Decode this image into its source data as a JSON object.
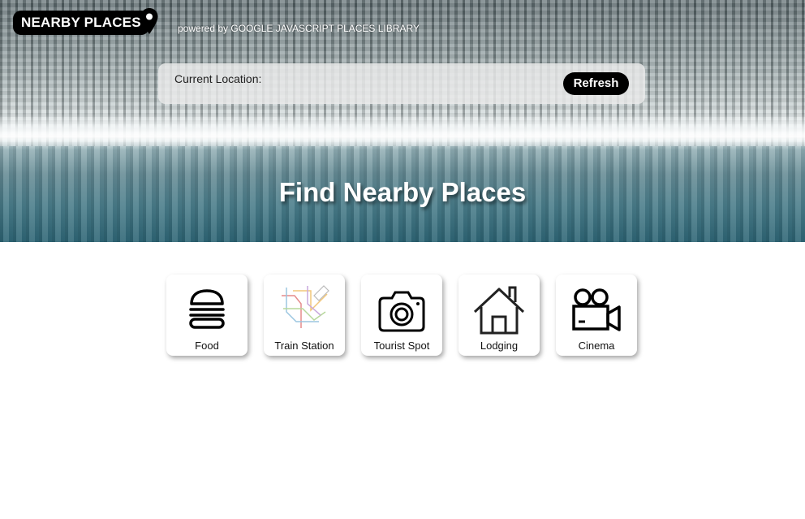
{
  "header": {
    "brand": "NEARBY PLACES",
    "powered_by": "powered by GOOGLE JAVASCRIPT PLACES LIBRARY",
    "pin_icon": "map-pin-icon"
  },
  "location": {
    "label": "Current Location:",
    "refresh_label": "Refresh"
  },
  "hero": {
    "title": "Find Nearby Places"
  },
  "categories": [
    {
      "label": "Food",
      "icon": "burger-icon"
    },
    {
      "label": "Train Station",
      "icon": "train-map-icon"
    },
    {
      "label": "Tourist Spot",
      "icon": "camera-icon"
    },
    {
      "label": "Lodging",
      "icon": "house-icon"
    },
    {
      "label": "Cinema",
      "icon": "movie-camera-icon"
    }
  ],
  "colors": {
    "accent": "#000000",
    "text_light": "#ffffff"
  }
}
